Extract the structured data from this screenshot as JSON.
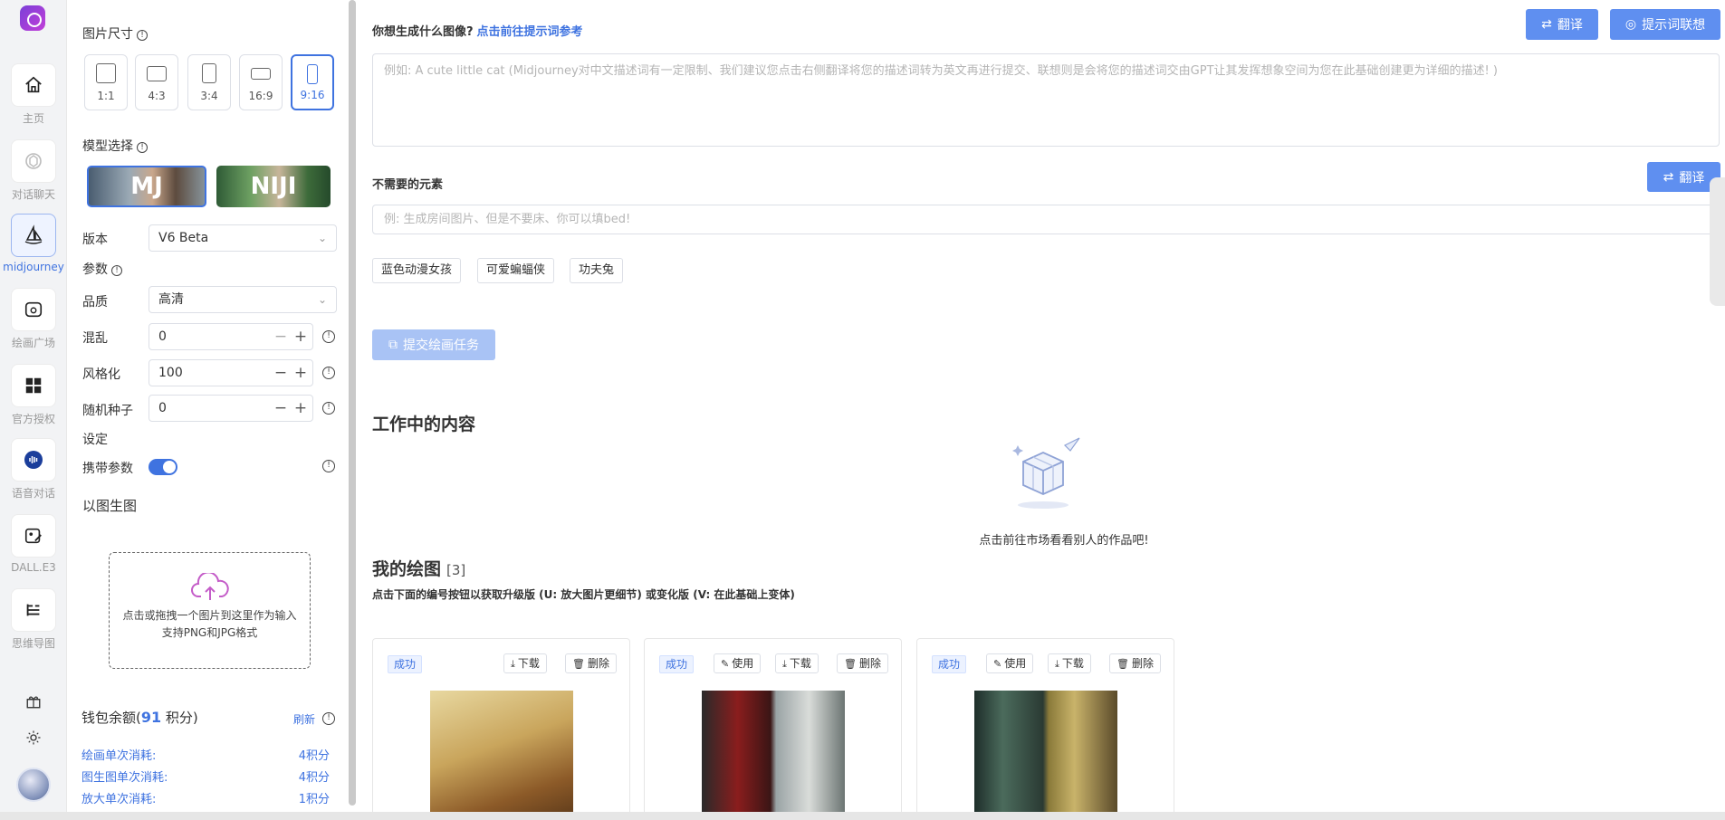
{
  "rail": {
    "items": [
      {
        "label": "主页",
        "icon": "home-icon"
      },
      {
        "label": "对话聊天",
        "icon": "chat-icon"
      },
      {
        "label": "midjourney",
        "icon": "sailboat-icon"
      },
      {
        "label": "绘画广场",
        "icon": "gallery-icon"
      },
      {
        "label": "官方授权",
        "icon": "apps-icon"
      },
      {
        "label": "语音对话",
        "icon": "voice-icon"
      },
      {
        "label": "DALL.E3",
        "icon": "image-edit-icon"
      },
      {
        "label": "思维导图",
        "icon": "mindmap-icon"
      }
    ]
  },
  "settings": {
    "size_title": "图片尺寸",
    "sizes": [
      {
        "label": "1:1"
      },
      {
        "label": "4:3"
      },
      {
        "label": "3:4"
      },
      {
        "label": "16:9"
      },
      {
        "label": "9:16"
      }
    ],
    "model_title": "模型选择",
    "models": [
      {
        "label": "MJ"
      },
      {
        "label": "NIJI"
      }
    ],
    "version_label": "版本",
    "version_value": "V6 Beta",
    "params_title": "参数",
    "quality_label": "品质",
    "quality_value": "高清",
    "chaos_label": "混乱",
    "chaos_value": "0",
    "stylize_label": "风格化",
    "stylize_value": "100",
    "seed_label": "随机种子",
    "seed_value": "0",
    "settings_title": "设定",
    "carry_params_label": "携带参数",
    "img2img_title": "以图生图",
    "upload_line1": "点击或拖拽一个图片到这里作为输入",
    "upload_line2": "支持PNG和JPG格式",
    "wallet_prefix": "钱包余额(",
    "wallet_value": "91",
    "wallet_suffix": " 积分)",
    "refresh_label": "刷新",
    "costs": [
      {
        "label": "绘画单次消耗:",
        "value": "4积分"
      },
      {
        "label": "图生图单次消耗:",
        "value": "4积分"
      },
      {
        "label": "放大单次消耗:",
        "value": "1积分"
      }
    ]
  },
  "main": {
    "prompt_title": "你想生成什么图像?",
    "prompt_link": "点击前往提示词参考",
    "translate_label": "翻译",
    "assoc_label": "提示词联想",
    "prompt_placeholder": "例如: A cute little cat (Midjourney对中文描述词有一定限制、我们建议您点击右侧翻译将您的描述词转为英文再进行提交、联想则是会将您的描述词交由GPT让其发挥想象空间为您在此基础创建更为详细的描述! )",
    "negative_title": "不需要的元素",
    "negative_translate_label": "翻译",
    "negative_placeholder": "例: 生成房间图片、但是不要床、你可以填bed!",
    "tags": [
      "蓝色动漫女孩",
      "可爱蝙蝠侠",
      "功夫兔"
    ],
    "submit_label": "提交绘画任务",
    "working_title": "工作中的内容",
    "empty_text": "点击前往市场看看别人的作品吧!",
    "mine_title": "我的绘图",
    "mine_count": "[3]",
    "mine_desc": "点击下面的编号按钮以获取升级版 (U: 放大图片更细节) 或变化版 (V: 在此基础上变体)",
    "cards": [
      {
        "status": "成功",
        "actions": [
          "下载",
          "删除"
        ]
      },
      {
        "status": "成功",
        "actions": [
          "使用",
          "下载",
          "删除"
        ]
      },
      {
        "status": "成功",
        "actions": [
          "使用",
          "下载",
          "删除"
        ]
      }
    ]
  },
  "colors": {
    "accent": "#3f73e0",
    "button": "#5f8ff0",
    "submit_disabled": "#a9c3f5"
  }
}
